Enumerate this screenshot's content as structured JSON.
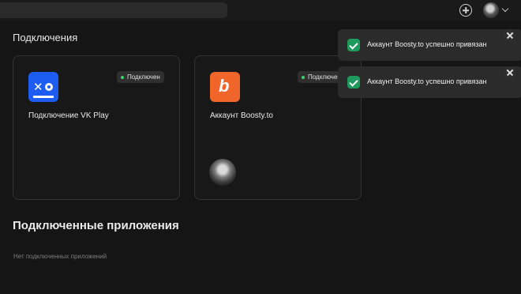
{
  "header": {
    "search_placeholder": "",
    "add_icon": "plus-circle-icon",
    "avatar_icon": "user-avatar",
    "menu_icon": "chevron-down-icon"
  },
  "connections": {
    "title": "Подключения",
    "cards": [
      {
        "title": "Подключение VK Play",
        "status": "Подключен",
        "icon": "vk-play-logo",
        "brand_color": "#1d5cf0"
      },
      {
        "title": "Аккаунт Boosty.to",
        "status": "Подключен",
        "icon": "boosty-logo",
        "brand_color": "#f0662a"
      }
    ]
  },
  "notifications": [
    {
      "text": "Аккаунт Boosty.to успешно привязан",
      "icon": "check-icon"
    },
    {
      "text": "Аккаунт Boosty.to успешно привязан",
      "icon": "check-icon"
    }
  ],
  "apps": {
    "title": "Подключенные приложения",
    "empty_text": "Нет подключенных приложений"
  },
  "colors": {
    "background": "#151515",
    "status_dot": "#3bd16f",
    "success": "#1e9a5d"
  }
}
